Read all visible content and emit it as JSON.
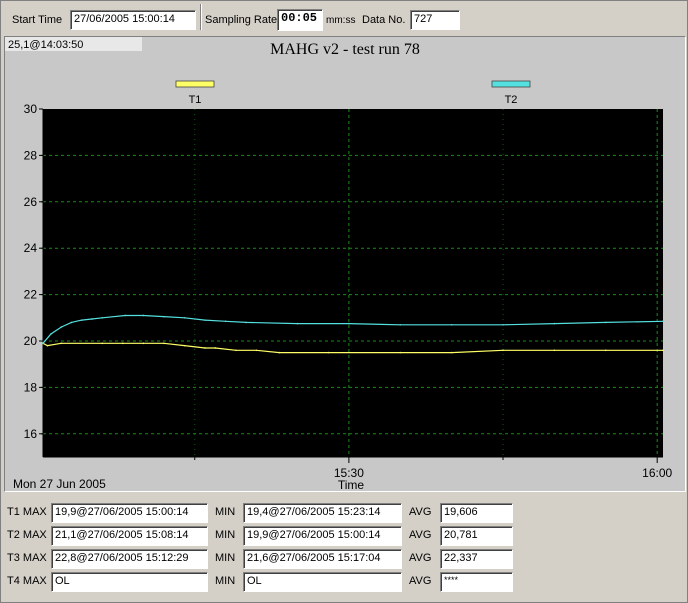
{
  "toolbar": {
    "start_time_label": "Start Time",
    "start_time_value": "27/06/2005 15:00:14",
    "sampling_rate_label": "Sampling Rate",
    "sampling_rate_value": "00:05",
    "sampling_rate_unit": "mm:ss",
    "data_no_label": "Data No.",
    "data_no_value": "727"
  },
  "cursor_readout": "25,1@14:03:50",
  "chart_data": {
    "type": "line",
    "title": "MAHG v2 - test run 78",
    "xlabel": "Time",
    "ylabel": "",
    "date_label": "Mon 27 Jun 2005",
    "x_tick_labels": [
      "15:30",
      "16:00"
    ],
    "xlim": [
      "15:00:14",
      "16:00:34"
    ],
    "ylim": [
      15,
      30
    ],
    "y_ticks": [
      16,
      18,
      20,
      22,
      24,
      26,
      28,
      30
    ],
    "grid": true,
    "legend_position": "top",
    "background": "#000000",
    "series": [
      {
        "name": "T1",
        "color": "#ffff66",
        "x": [
          "15:00:14",
          "15:00:40",
          "15:02:00",
          "15:06:00",
          "15:08:00",
          "15:10:00",
          "15:12:00",
          "15:14:00",
          "15:16:00",
          "15:17:00",
          "15:19:00",
          "15:21:00",
          "15:23:14",
          "15:28:00",
          "15:35:00",
          "15:40:00",
          "15:45:00",
          "15:50:00",
          "15:55:00",
          "16:00:34"
        ],
        "values": [
          19.9,
          19.8,
          19.9,
          19.9,
          19.9,
          19.9,
          19.9,
          19.8,
          19.7,
          19.7,
          19.6,
          19.6,
          19.5,
          19.5,
          19.5,
          19.5,
          19.6,
          19.6,
          19.6,
          19.6
        ]
      },
      {
        "name": "T2",
        "color": "#55e0e0",
        "x": [
          "15:00:14",
          "15:01:00",
          "15:02:00",
          "15:03:00",
          "15:04:00",
          "15:05:00",
          "15:06:00",
          "15:08:14",
          "15:10:00",
          "15:12:00",
          "15:14:00",
          "15:16:00",
          "15:18:00",
          "15:20:00",
          "15:25:00",
          "15:30:00",
          "15:35:00",
          "15:40:00",
          "15:45:00",
          "15:50:00",
          "15:55:00",
          "16:00:34"
        ],
        "values": [
          19.9,
          20.3,
          20.6,
          20.8,
          20.9,
          20.95,
          21.0,
          21.1,
          21.1,
          21.05,
          21.0,
          20.9,
          20.85,
          20.8,
          20.75,
          20.75,
          20.7,
          20.7,
          20.7,
          20.75,
          20.8,
          20.85
        ]
      }
    ]
  },
  "stats": {
    "max_label": "MAX",
    "min_label": "MIN",
    "avg_label": "AVG",
    "rows": [
      {
        "name": "T1",
        "max": "19,9@27/06/2005 15:00:14",
        "min": "19,4@27/06/2005 15:23:14",
        "avg": "19,606"
      },
      {
        "name": "T2",
        "max": "21,1@27/06/2005 15:08:14",
        "min": "19,9@27/06/2005 15:00:14",
        "avg": "20,781"
      },
      {
        "name": "T3",
        "max": "22,8@27/06/2005 15:12:29",
        "min": "21,6@27/06/2005 15:17:04",
        "avg": "22,337"
      },
      {
        "name": "T4",
        "max": "OL",
        "min": "OL",
        "avg": "****"
      }
    ]
  }
}
